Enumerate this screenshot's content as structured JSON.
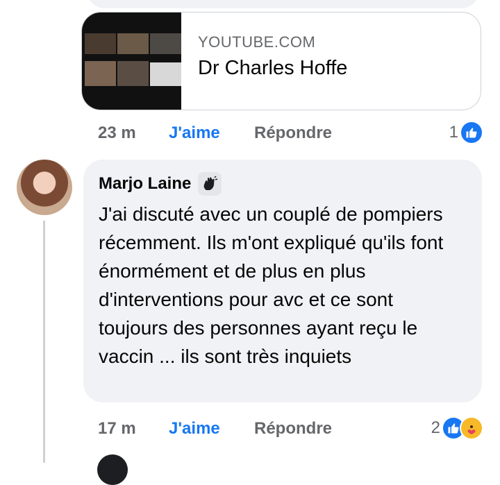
{
  "link_preview": {
    "domain": "YOUTUBE.COM",
    "title": "Dr Charles Hoffe"
  },
  "first_actions": {
    "time": "23 m",
    "like_label": "J'aime",
    "reply_label": "Répondre",
    "reaction_count": "1",
    "reaction_icons": [
      "like-icon"
    ]
  },
  "comment": {
    "author": "Marjo Laine",
    "badge_icon": "waving-hand-icon",
    "text": "J'ai discuté avec un couplé de pompiers récemment. Ils m'ont expliqué qu'ils font énormément et de plus en plus d'interventions pour avc et ce sont toujours des personnes ayant reçu le vaccin ... ils sont très inquiets"
  },
  "comment_actions": {
    "time": "17 m",
    "like_label": "J'aime",
    "reply_label": "Répondre",
    "reaction_count": "2",
    "reaction_icons": [
      "like-icon",
      "care-icon"
    ]
  },
  "colors": {
    "accent": "#1877f2",
    "bubble": "#f0f2f5",
    "muted_text": "#65676b",
    "care": "#f7b928"
  }
}
